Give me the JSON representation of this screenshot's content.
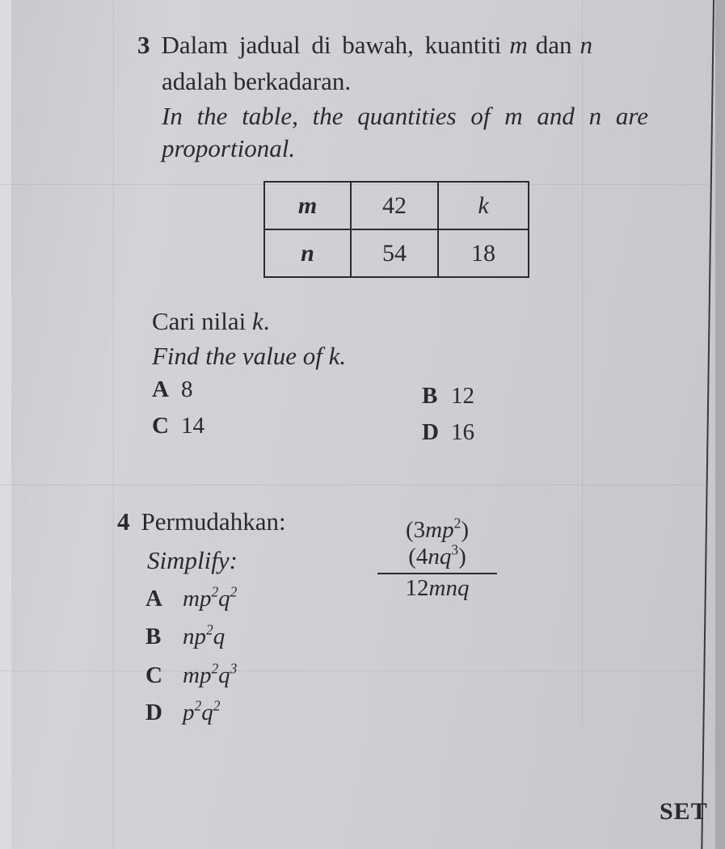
{
  "question3": {
    "number": "3",
    "malay_line1": "Dalam jadual di bawah, kuantiti",
    "var_m": "m",
    "conj": "dan",
    "var_n": "n",
    "malay_line2": "adalah berkadaran.",
    "english_line1": "In the table, the quantities of m and n are",
    "english_line2": "proportional.",
    "table": {
      "rows": [
        {
          "label": "m",
          "values": [
            "42",
            "k"
          ]
        },
        {
          "label": "n",
          "values": [
            "54",
            "18"
          ]
        }
      ]
    },
    "prompt_malay_prefix": "Cari nilai",
    "prompt_var": "k",
    "prompt_malay_suffix": ".",
    "prompt_english": "Find the value of k.",
    "options": [
      {
        "letter": "A",
        "value": "8"
      },
      {
        "letter": "B",
        "value": "12"
      },
      {
        "letter": "C",
        "value": "14"
      },
      {
        "letter": "D",
        "value": "16"
      }
    ]
  },
  "question4": {
    "number": "4",
    "malay_prompt": "Permudahkan:",
    "english_prompt": "Simplify:",
    "numerator": {
      "part1_open": "(3",
      "part1_vars": "mp",
      "part1_exp": "2",
      "part1_close": ")(4",
      "part2_vars": "nq",
      "part2_exp": "3",
      "part2_close": ")"
    },
    "denominator": {
      "coef": "12",
      "vars": "mnq"
    },
    "options": [
      {
        "letter": "A",
        "terms": [
          {
            "base": "mp",
            "exp": "2"
          },
          {
            "base": "q",
            "exp": "2"
          }
        ]
      },
      {
        "letter": "B",
        "terms": [
          {
            "base": "np",
            "exp": "2"
          },
          {
            "base": "q",
            "exp": ""
          }
        ]
      },
      {
        "letter": "C",
        "terms": [
          {
            "base": "mp",
            "exp": "2"
          },
          {
            "base": "q",
            "exp": "3"
          }
        ]
      },
      {
        "letter": "D",
        "terms": [
          {
            "base": "p",
            "exp": "2"
          },
          {
            "base": "q",
            "exp": "2"
          }
        ]
      }
    ]
  },
  "footer": {
    "label": "SET"
  }
}
